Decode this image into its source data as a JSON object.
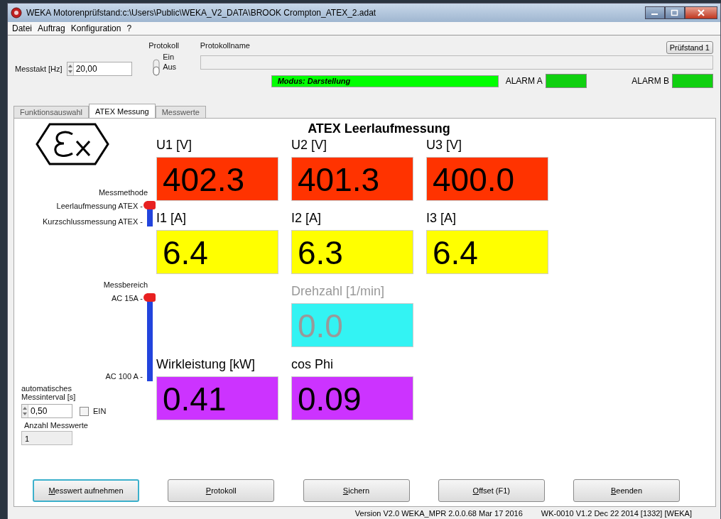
{
  "window": {
    "title": "WEKA Motorenprüfstand:c:\\Users\\Public\\WEKA_V2_DATA\\BROOK Crompton_ATEX_2.adat"
  },
  "menu": [
    "Datei",
    "Auftrag",
    "Konfiguration",
    "?"
  ],
  "top": {
    "messtakt": {
      "label": "Messtakt [Hz]",
      "value": "20,00"
    },
    "protokoll": {
      "label": "Protokoll",
      "on_label": "Ein",
      "off_label": "Aus",
      "on": false
    },
    "protokollname": {
      "label": "Protokollname"
    },
    "pruefstand_button": "Prüfstand 1",
    "modus": "Modus: Darstellung",
    "alarms": [
      {
        "label": "ALARM A",
        "color": "#10d010"
      },
      {
        "label": "ALARM B",
        "color": "#10d010"
      }
    ]
  },
  "tabs": [
    {
      "label": "Funktionsauswahl",
      "selected": false
    },
    {
      "label": "ATEX Messung",
      "selected": true
    },
    {
      "label": "Messwerte",
      "selected": false
    }
  ],
  "panel": {
    "title": "ATEX Leerlaufmessung",
    "switches": [
      {
        "label": "Messmethode",
        "options": [
          {
            "label": "Leerlaufmessung ATEX -",
            "selected": true
          },
          {
            "label": "Kurzschlussmessung ATEX -",
            "selected": false
          }
        ]
      },
      {
        "label": "Messbereich",
        "options": [
          {
            "label": "AC 15A -",
            "selected": true
          },
          {
            "label": "AC 100 A -",
            "selected": false
          }
        ]
      }
    ],
    "interval": {
      "label": "automatisches Messinterval [s]",
      "value": "0,50",
      "checkbox": {
        "label": "EIN",
        "checked": false
      }
    },
    "count": {
      "label": "Anzahl Messwerte",
      "value": "1"
    },
    "rows": [
      [
        {
          "label": "U1 [V]",
          "value": "402.3",
          "color": "#ff3300",
          "disabled": false
        },
        {
          "label": "U2 [V]",
          "value": "401.3",
          "color": "#ff3300",
          "disabled": false
        },
        {
          "label": "U3 [V]",
          "value": "400.0",
          "color": "#ff3300",
          "disabled": false
        }
      ],
      [
        {
          "label": "I1 [A]",
          "value": "6.4",
          "color": "#ffff00",
          "disabled": false
        },
        {
          "label": "I2 [A]",
          "value": "6.3",
          "color": "#ffff00",
          "disabled": false
        },
        {
          "label": "I3 [A]",
          "value": "6.4",
          "color": "#ffff00",
          "disabled": false
        }
      ],
      [
        null,
        {
          "label": "Drehzahl [1/min]",
          "value": "0.0",
          "color": "#33f3f3",
          "disabled": true
        },
        null
      ],
      [
        {
          "label": "Wirkleistung [kW]",
          "value": "0.41",
          "color": "#cc33ff",
          "disabled": false
        },
        {
          "label": "cos Phi",
          "value": "0.09",
          "color": "#cc33ff",
          "disabled": false
        },
        null
      ]
    ],
    "buttons": [
      {
        "label": "Messwert aufnehmen",
        "focused": true
      },
      {
        "label": "Protokoll",
        "focused": false
      },
      {
        "label": "Sichern",
        "focused": false
      },
      {
        "label": "Offset (F1)",
        "focused": false
      },
      {
        "label": "Beenden",
        "focused": false
      }
    ]
  },
  "status": [
    "Version V2.0 WEKA_MPR 2.0.0.68 Mar 17 2016",
    "WK-0010 V1.2  Dec 22 2014 [1332] [WEKA]"
  ]
}
